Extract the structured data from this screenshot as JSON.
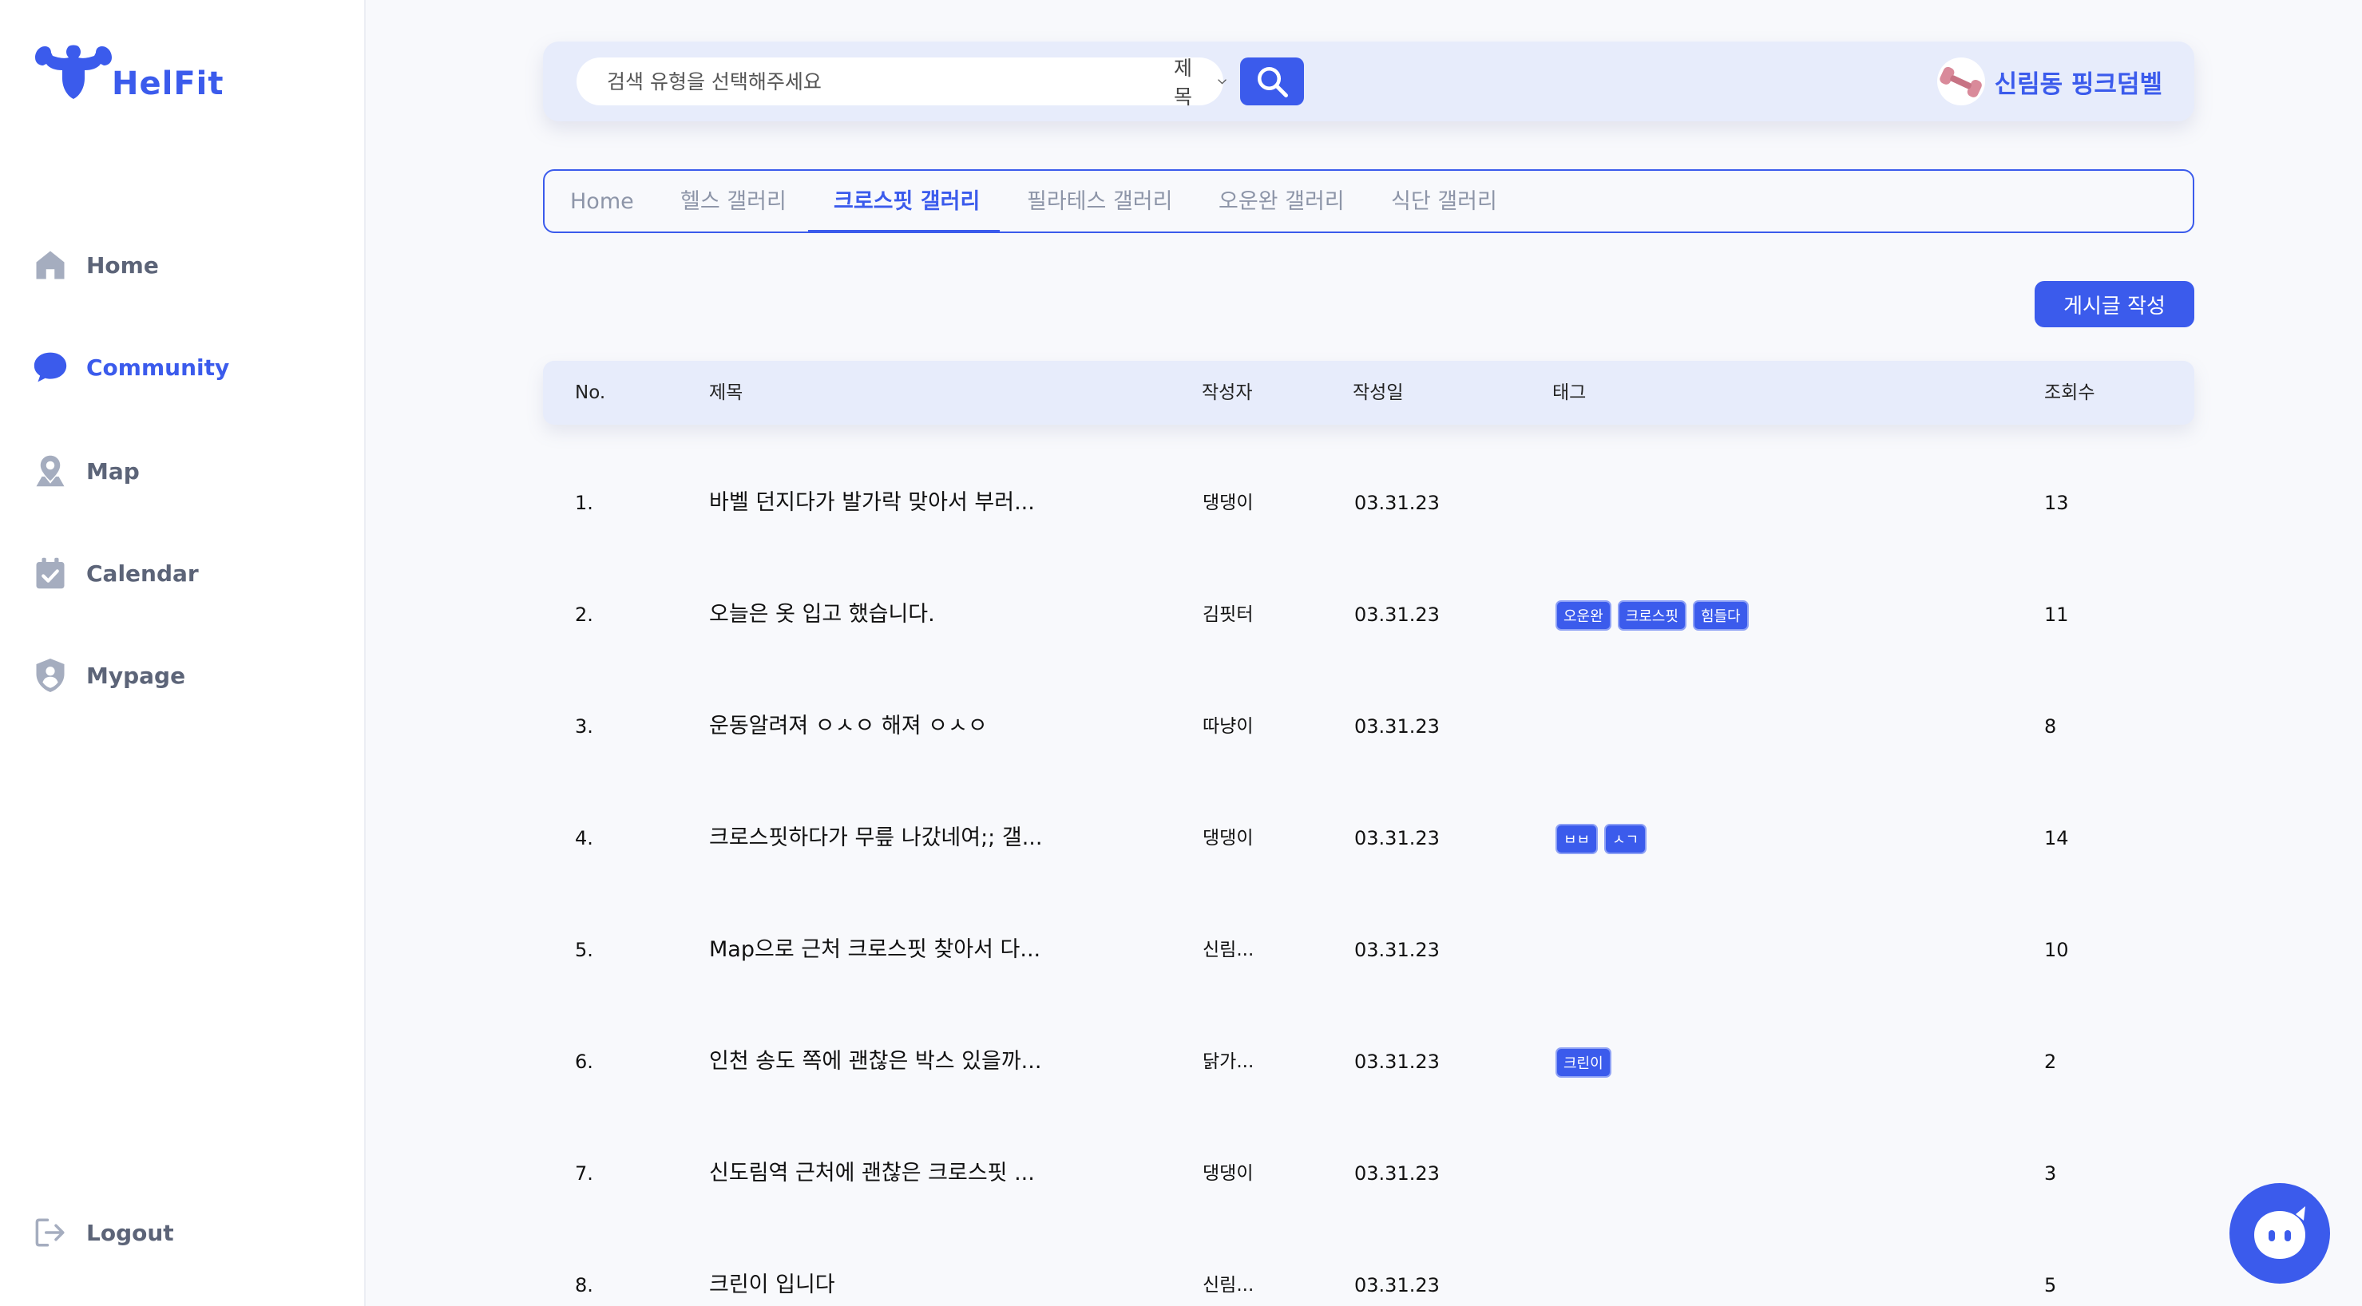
{
  "app": {
    "logo_text": "HelFit"
  },
  "colors": {
    "accent": "#3b5bec",
    "header_bg": "#e7ecfb",
    "nav_inactive": "#5c6478",
    "tab_inactive": "#8d95a8"
  },
  "sidebar": {
    "items": [
      {
        "label": "Home",
        "icon": "home-icon"
      },
      {
        "label": "Community",
        "icon": "chat-bubble-icon"
      },
      {
        "label": "Map",
        "icon": "map-pin-icon"
      },
      {
        "label": "Calendar",
        "icon": "calendar-check-icon"
      },
      {
        "label": "Mypage",
        "icon": "user-shield-icon"
      }
    ],
    "logout_label": "Logout"
  },
  "search": {
    "placeholder": "검색 유형을 선택해주세요",
    "type_selected": "제목"
  },
  "profile": {
    "name": "신림동 핑크덤벨"
  },
  "tabs": [
    {
      "label": "Home"
    },
    {
      "label": "헬스 갤러리"
    },
    {
      "label": "크로스핏 갤러리"
    },
    {
      "label": "필라테스 갤러리"
    },
    {
      "label": "오운완 갤러리"
    },
    {
      "label": "식단 갤러리"
    }
  ],
  "write_button_label": "게시글 작성",
  "table": {
    "headers": {
      "no": "No.",
      "title": "제목",
      "author": "작성자",
      "date": "작성일",
      "tags": "태그",
      "views": "조회수"
    },
    "rows": [
      {
        "no": "1.",
        "title": "바벨 던지다가 발가락 맞아서 부러...",
        "author": "댕댕이",
        "date": "03.31.23",
        "tags": [],
        "views": "13"
      },
      {
        "no": "2.",
        "title": "오늘은 옷 입고 했습니다.",
        "author": "김핏터",
        "date": "03.31.23",
        "tags": [
          "오운완",
          "크로스핏",
          "힘들다"
        ],
        "views": "11"
      },
      {
        "no": "3.",
        "title": "운동알려져 ㅇㅅㅇ 해져 ㅇㅅㅇ",
        "author": "따냥이",
        "date": "03.31.23",
        "tags": [],
        "views": "8"
      },
      {
        "no": "4.",
        "title": "크로스핏하다가 무릎 나갔네여;; 갤...",
        "author": "댕댕이",
        "date": "03.31.23",
        "tags": [
          "ㅂㅂ",
          "ㅅㄱ"
        ],
        "views": "14"
      },
      {
        "no": "5.",
        "title": "Map으로 근처 크로스핏 찾아서 다...",
        "author": "신림...",
        "date": "03.31.23",
        "tags": [],
        "views": "10"
      },
      {
        "no": "6.",
        "title": "인천 송도 쪽에 괜찮은 박스 있을까...",
        "author": "닭가...",
        "date": "03.31.23",
        "tags": [
          "크린이"
        ],
        "views": "2"
      },
      {
        "no": "7.",
        "title": "신도림역 근처에 괜찮은 크로스핏 ...",
        "author": "댕댕이",
        "date": "03.31.23",
        "tags": [],
        "views": "3"
      },
      {
        "no": "8.",
        "title": "크린이 입니다",
        "author": "신림...",
        "date": "03.31.23",
        "tags": [],
        "views": "5"
      }
    ]
  }
}
